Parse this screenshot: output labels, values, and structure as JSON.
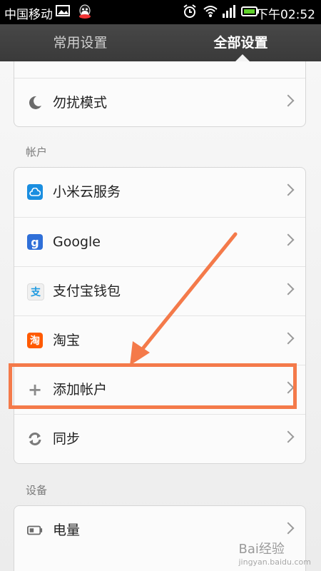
{
  "status_bar": {
    "carrier": "中国移动",
    "time": "下午02:52"
  },
  "tabs": {
    "common": "常用设置",
    "all": "全部设置"
  },
  "top_card": {
    "dnd_label": "勿扰模式"
  },
  "sections": {
    "accounts_title": "帐户",
    "device_title": "设备"
  },
  "accounts": [
    {
      "label": "小米云服务",
      "icon": "cloud-icon",
      "color": "#1a8ee0"
    },
    {
      "label": "Google",
      "icon": "google-g-icon",
      "color": "#2f6fd8"
    },
    {
      "label": "支付宝钱包",
      "icon": "alipay-icon",
      "color": "#1f9ae0"
    },
    {
      "label": "淘宝",
      "icon": "taobao-icon",
      "color": "#ff5a00"
    },
    {
      "label": "添加帐户",
      "icon": "plus-icon",
      "color": "#8a8a8a"
    },
    {
      "label": "同步",
      "icon": "sync-icon",
      "color": "#7a7a7a"
    }
  ],
  "device": {
    "battery_label": "电量"
  },
  "watermark": {
    "brand": "Bai经验",
    "url": "jingyan.baidu.com"
  },
  "colors": {
    "annotation": "#f47a4a",
    "tabbar": "#3f3f3f"
  }
}
